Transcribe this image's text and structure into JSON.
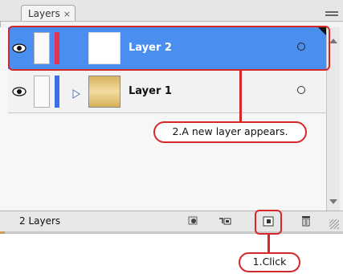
{
  "panel": {
    "tab_label": "Layers",
    "tab_close": "×"
  },
  "layers": [
    {
      "name": "Layer 2",
      "selected": true,
      "color": "#e8334f",
      "has_children": false
    },
    {
      "name": "Layer 1",
      "selected": false,
      "color": "#3b6fe6",
      "has_children": true
    }
  ],
  "footer": {
    "count_label": "2 Layers",
    "buttons": [
      "make-clipping-mask-icon",
      "create-sublayer-icon",
      "create-new-layer-icon",
      "delete-layer-icon"
    ]
  },
  "annotations": {
    "new_layer_note": "2.A new layer appears.",
    "click_note": "1.Click",
    "highlight_color": "#d62828"
  }
}
